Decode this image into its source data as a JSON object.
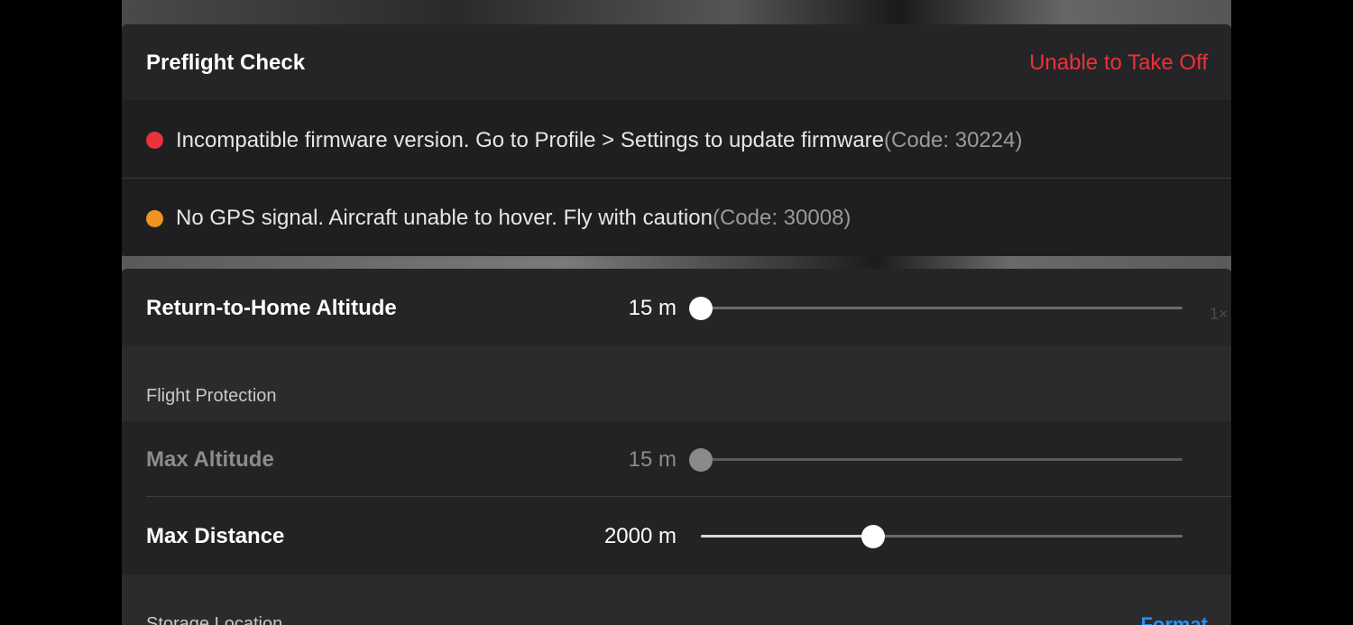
{
  "preflight": {
    "title": "Preflight Check",
    "status": "Unable to Take Off",
    "status_color": "#e8323c",
    "warnings": [
      {
        "severity": "error",
        "color": "#e8323c",
        "message": "Incompatible firmware version. Go to Profile > Settings to update firmware",
        "code": "(Code: 30224)"
      },
      {
        "severity": "warning",
        "color": "#ef9321",
        "message": "No GPS signal. Aircraft unable to hover. Fly with caution",
        "code": "(Code: 30008)"
      }
    ]
  },
  "rth": {
    "label": "Return-to-Home Altitude",
    "value_text": "15 m",
    "slider_fraction": 0.0
  },
  "zoom_hint": "1×",
  "flight_protection": {
    "section_label": "Flight Protection",
    "max_altitude": {
      "label": "Max Altitude",
      "value_text": "15 m",
      "slider_fraction": 0.0,
      "enabled": false
    },
    "max_distance": {
      "label": "Max Distance",
      "value_text": "2000 m",
      "slider_fraction": 0.357,
      "enabled": true
    }
  },
  "storage": {
    "section_label": "Storage Location",
    "format_label": "Format",
    "accent_color": "#2a8ff0"
  }
}
